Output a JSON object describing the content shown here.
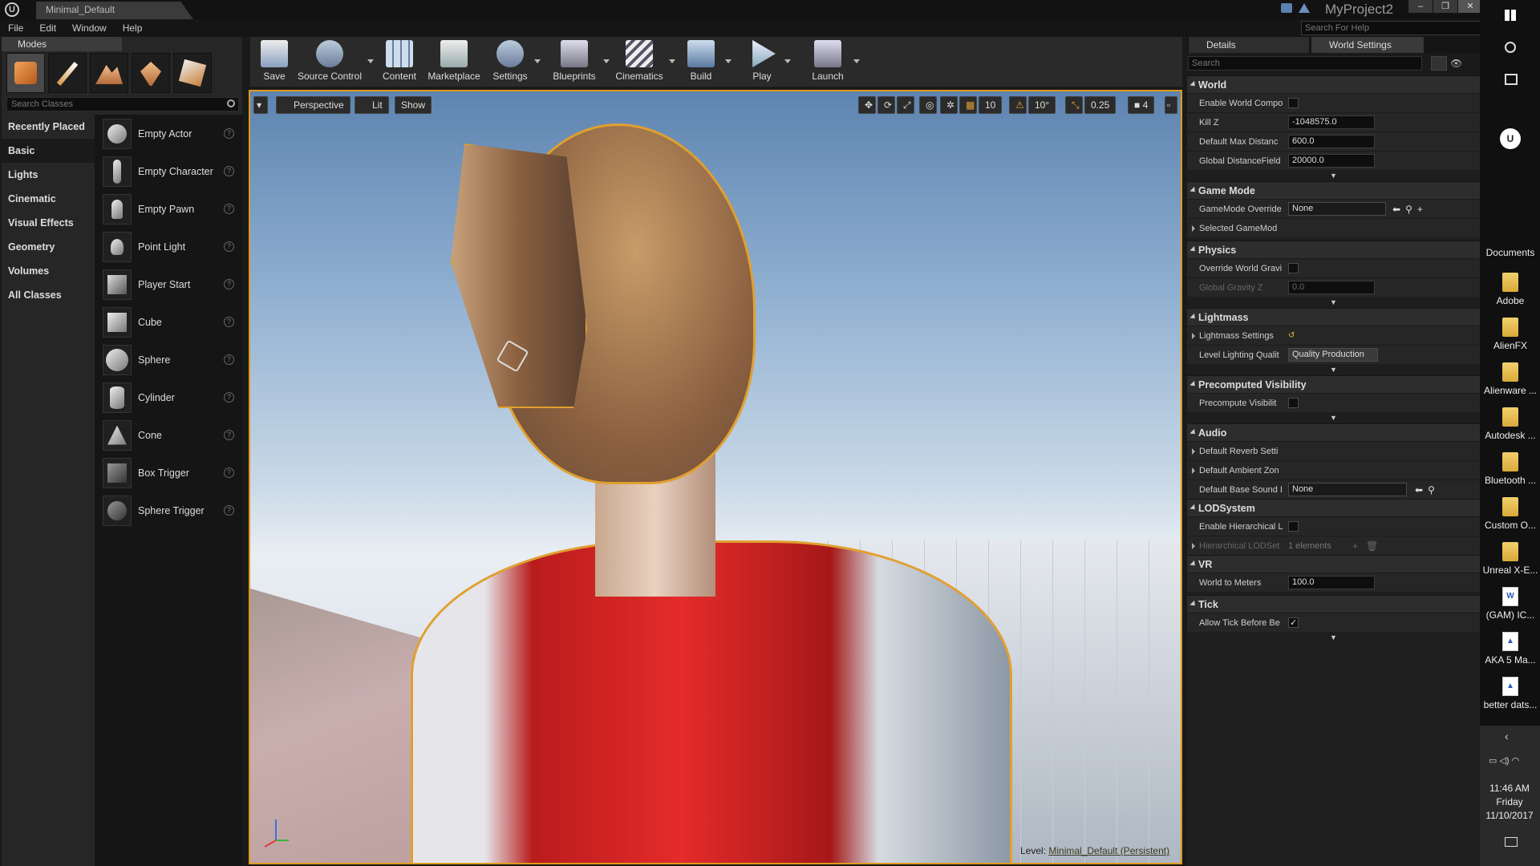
{
  "window": {
    "doc_tab": "Minimal_Default",
    "project_name": "MyProject2",
    "help_placeholder": "Search For Help"
  },
  "menu": [
    "File",
    "Edit",
    "Window",
    "Help"
  ],
  "modes": {
    "tab": "Modes",
    "search_placeholder": "Search Classes",
    "categories": [
      "Recently Placed",
      "Basic",
      "Lights",
      "Cinematic",
      "Visual Effects",
      "Geometry",
      "Volumes",
      "All Classes"
    ],
    "selected_category": "Basic",
    "items": [
      "Empty Actor",
      "Empty Character",
      "Empty Pawn",
      "Point Light",
      "Player Start",
      "Cube",
      "Sphere",
      "Cylinder",
      "Cone",
      "Box Trigger",
      "Sphere Trigger"
    ]
  },
  "toolbar": {
    "save": "Save",
    "source_control": "Source Control",
    "content": "Content",
    "marketplace": "Marketplace",
    "settings": "Settings",
    "blueprints": "Blueprints",
    "cinematics": "Cinematics",
    "build": "Build",
    "play": "Play",
    "launch": "Launch"
  },
  "viewport": {
    "perspective": "Perspective",
    "lit": "Lit",
    "show": "Show",
    "grid_snap": "10",
    "rot_snap": "10°",
    "scale_snap": "0.25",
    "cam_speed": "4",
    "level_prefix": "Level:",
    "level_name": "Minimal_Default (Persistent)"
  },
  "details": {
    "tab_details": "Details",
    "tab_world": "World Settings",
    "search_placeholder": "Search",
    "world": {
      "title": "World",
      "enable_world_comp": "Enable World Compo",
      "kill_z": "Kill Z",
      "kill_z_val": "-1048575.0",
      "max_dist": "Default Max Distanc",
      "max_dist_val": "600.0",
      "gdf": "Global DistanceField",
      "gdf_val": "20000.0"
    },
    "game_mode": {
      "title": "Game Mode",
      "override": "GameMode Override",
      "override_val": "None",
      "selected": "Selected GameMod"
    },
    "physics": {
      "title": "Physics",
      "override_grav": "Override World Gravi",
      "grav_z": "Global Gravity Z",
      "grav_z_val": "0.0"
    },
    "lightmass": {
      "title": "Lightmass",
      "settings": "Lightmass Settings",
      "quality": "Level Lighting Qualit",
      "quality_val": "Quality Production"
    },
    "precomputed": {
      "title": "Precomputed Visibility",
      "precompute": "Precompute Visibilit"
    },
    "audio": {
      "title": "Audio",
      "reverb": "Default Reverb Setti",
      "ambient": "Default Ambient Zon",
      "base_sound": "Default Base Sound I",
      "base_sound_val": "None"
    },
    "lod": {
      "title": "LODSystem",
      "enable": "Enable Hierarchical L",
      "settings": "Hierarchical LODSet",
      "settings_val": "1 elements"
    },
    "vr": {
      "title": "VR",
      "meters": "World to Meters",
      "meters_val": "100.0"
    },
    "tick": {
      "title": "Tick",
      "allow": "Allow Tick Before Be"
    }
  },
  "desktop": {
    "documents": "Documents",
    "icons": [
      "Adobe",
      "AlienFX",
      "Alienware ...",
      "Autodesk ...",
      "Bluetooth ...",
      "Custom O...",
      "Unreal X-E...",
      "(GAM) IC...",
      "AKA 5 Ma...",
      "better dats..."
    ],
    "time": "11:46 AM",
    "day": "Friday",
    "date": "11/10/2017"
  },
  "colors": {
    "selection_outline": "#e09a1a",
    "panel_bg": "#262626",
    "dark_bg": "#151515"
  }
}
